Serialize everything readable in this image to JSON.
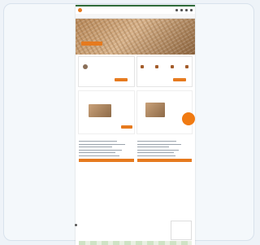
{
  "colors": {
    "accent": "#e67a1e",
    "topbar": "#2f6b3a",
    "badge": "#f07a12"
  },
  "header": {
    "logo_icon": "logo-icon",
    "icons": [
      "search-icon",
      "user-icon",
      "cart-icon",
      "menu-icon"
    ]
  },
  "nav": {
    "items": [
      "",
      "",
      "",
      "",
      ""
    ]
  },
  "hero": {
    "title": "",
    "subtitle": "",
    "button": ""
  },
  "cards": [
    {
      "title": ""
    },
    {
      "title": ""
    }
  ],
  "promo": {
    "badge": ""
  },
  "section": {
    "title": ""
  },
  "columns": [
    {
      "title": ""
    },
    {
      "title": ""
    }
  ]
}
